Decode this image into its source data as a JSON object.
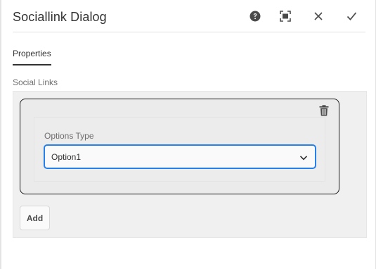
{
  "dialog": {
    "title": "Sociallink Dialog",
    "actions": [
      {
        "name": "help",
        "icon": "help-circle-icon"
      },
      {
        "name": "fullscreen",
        "icon": "fullscreen-icon"
      },
      {
        "name": "close",
        "icon": "close-icon"
      },
      {
        "name": "done",
        "icon": "checkmark-icon"
      }
    ]
  },
  "tabs": [
    {
      "label": "Properties",
      "selected": true
    }
  ],
  "social_links": {
    "label": "Social Links",
    "items": [
      {
        "field_label": "Options Type",
        "selected_value": "Option1",
        "delete_icon": "trash-icon"
      }
    ],
    "add_label": "Add"
  },
  "colors": {
    "accent": "#2680eb",
    "text": "#323232",
    "label": "#6e6e6e",
    "item_border": "#1a1a1a"
  }
}
